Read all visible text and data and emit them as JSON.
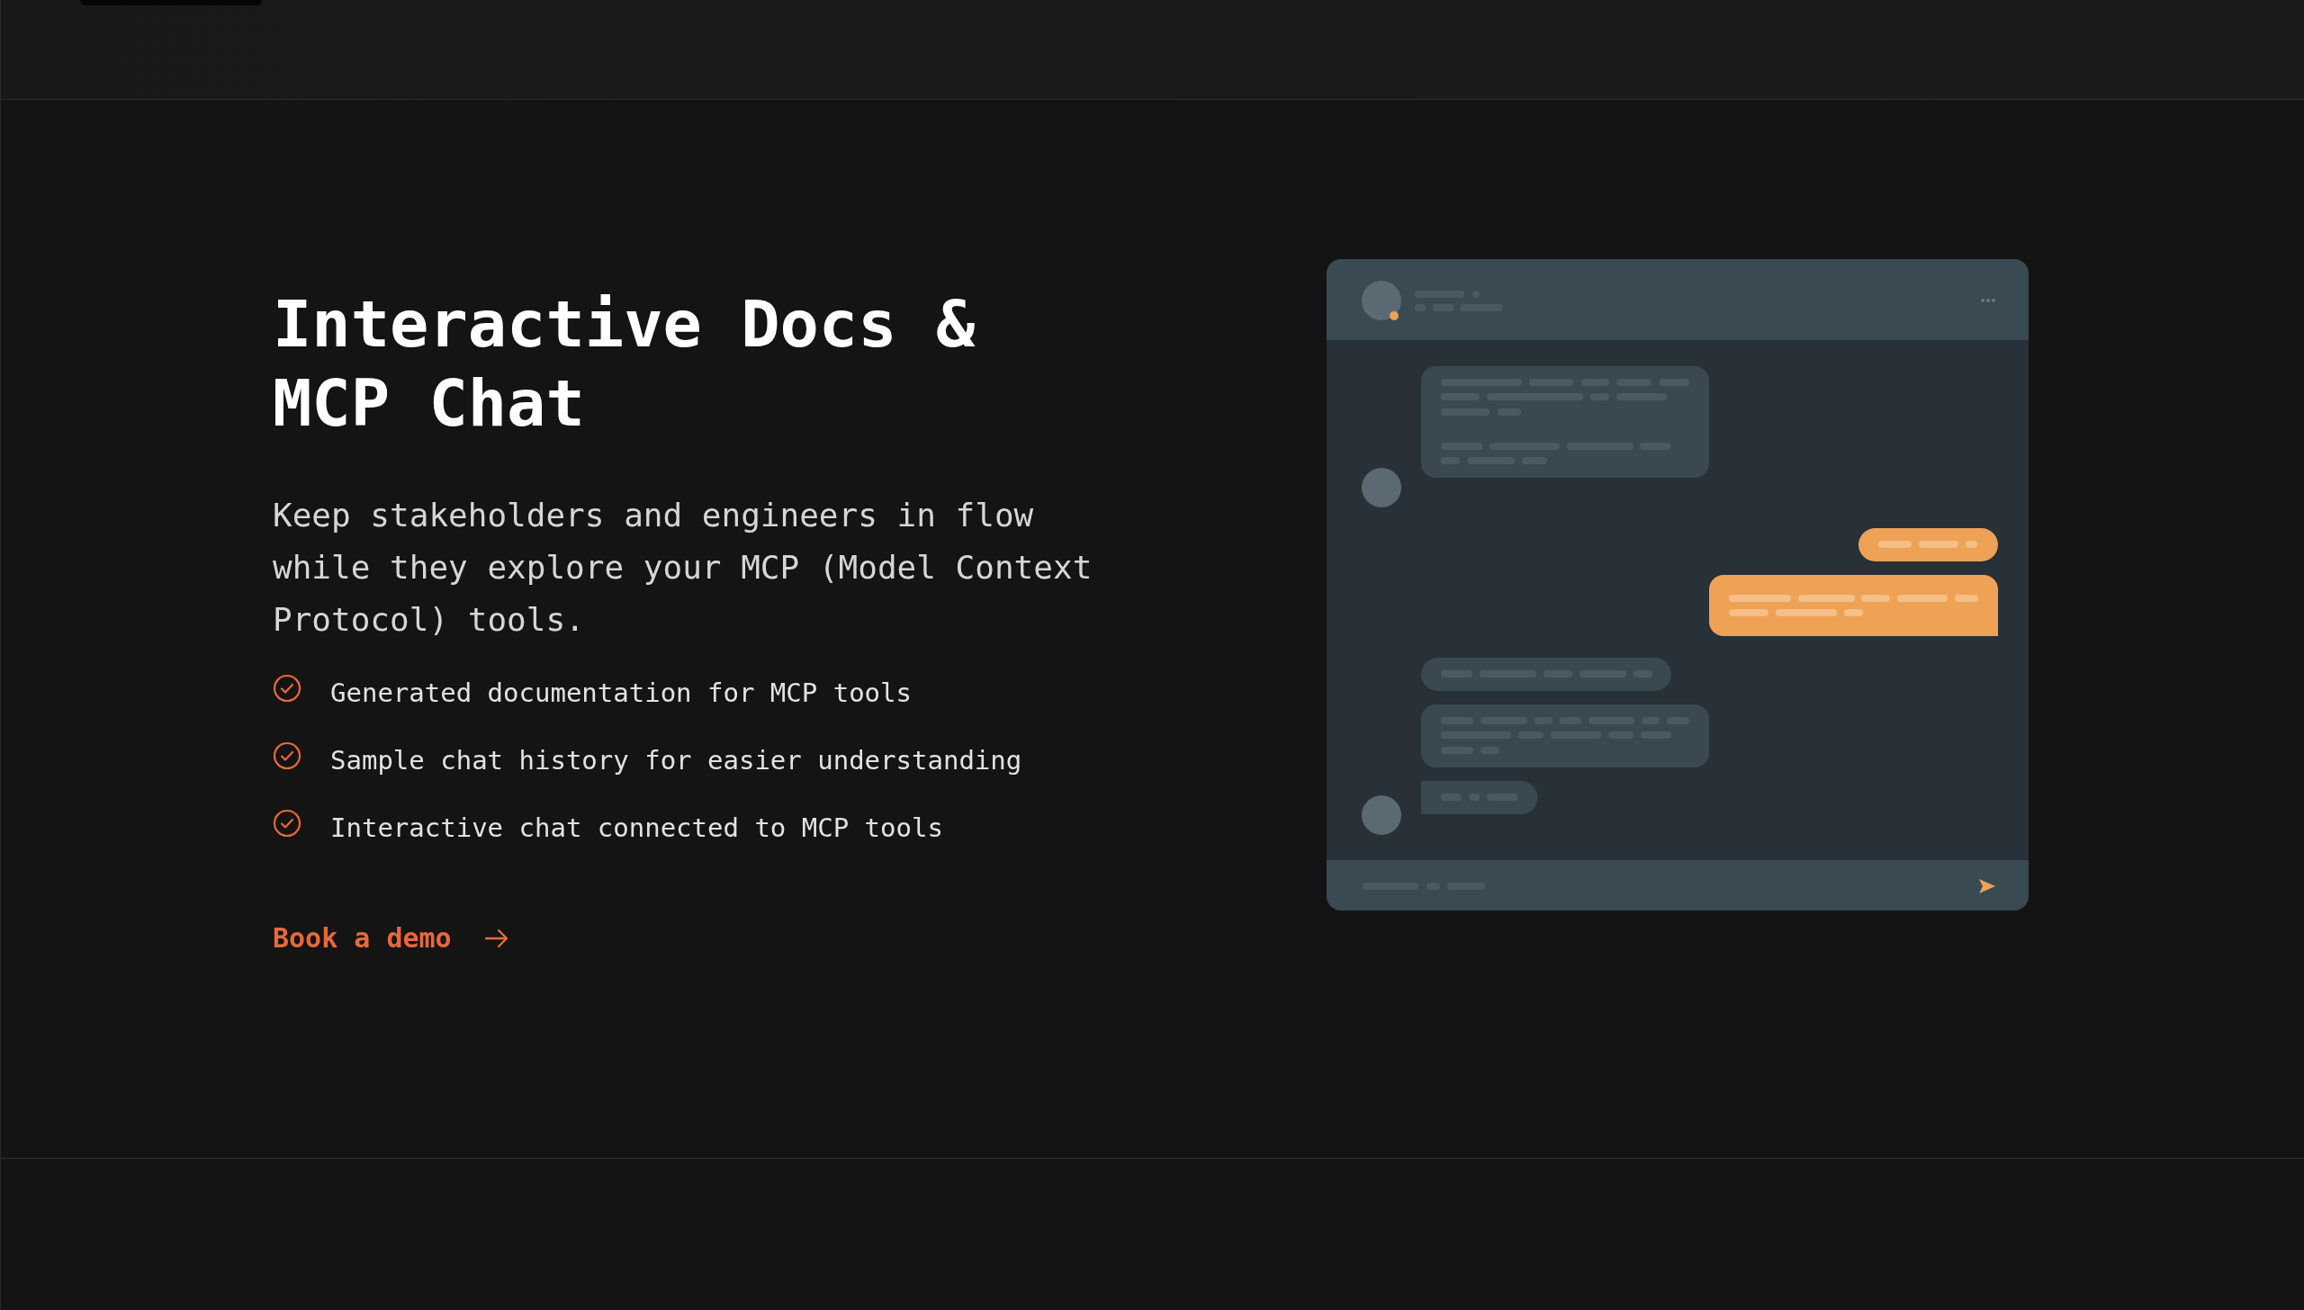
{
  "hero": {
    "title": "Interactive Docs & MCP Chat",
    "description": "Keep stakeholders and engineers in flow while they explore your MCP (Model Context Protocol) tools.",
    "features": [
      "Generated documentation for MCP tools",
      "Sample chat history for easier understanding",
      "Interactive chat connected to MCP tools"
    ],
    "cta": {
      "label": "Book a demo"
    }
  }
}
